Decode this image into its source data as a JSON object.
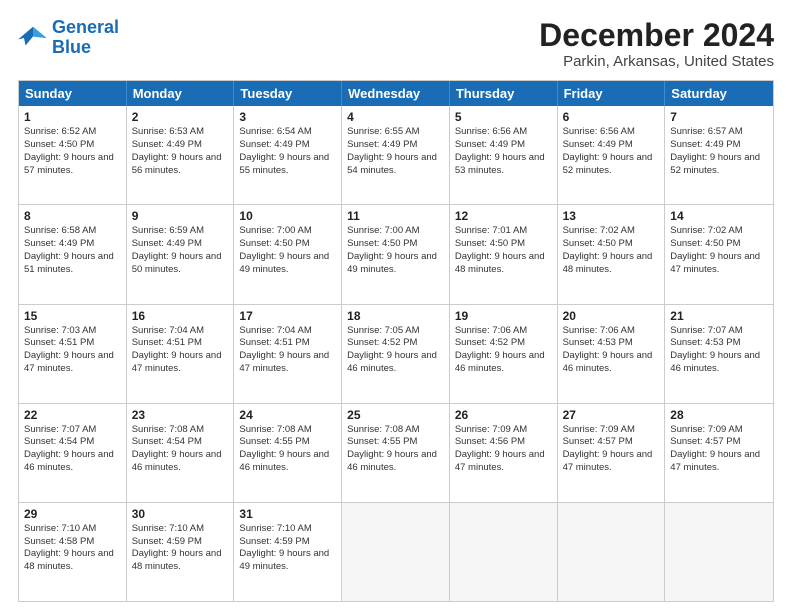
{
  "logo": {
    "line1": "General",
    "line2": "Blue"
  },
  "title": "December 2024",
  "subtitle": "Parkin, Arkansas, United States",
  "days": [
    "Sunday",
    "Monday",
    "Tuesday",
    "Wednesday",
    "Thursday",
    "Friday",
    "Saturday"
  ],
  "weeks": [
    [
      {
        "num": "1",
        "rise": "6:52 AM",
        "set": "4:50 PM",
        "daylight": "9 hours and 57 minutes."
      },
      {
        "num": "2",
        "rise": "6:53 AM",
        "set": "4:49 PM",
        "daylight": "9 hours and 56 minutes."
      },
      {
        "num": "3",
        "rise": "6:54 AM",
        "set": "4:49 PM",
        "daylight": "9 hours and 55 minutes."
      },
      {
        "num": "4",
        "rise": "6:55 AM",
        "set": "4:49 PM",
        "daylight": "9 hours and 54 minutes."
      },
      {
        "num": "5",
        "rise": "6:56 AM",
        "set": "4:49 PM",
        "daylight": "9 hours and 53 minutes."
      },
      {
        "num": "6",
        "rise": "6:56 AM",
        "set": "4:49 PM",
        "daylight": "9 hours and 52 minutes."
      },
      {
        "num": "7",
        "rise": "6:57 AM",
        "set": "4:49 PM",
        "daylight": "9 hours and 52 minutes."
      }
    ],
    [
      {
        "num": "8",
        "rise": "6:58 AM",
        "set": "4:49 PM",
        "daylight": "9 hours and 51 minutes."
      },
      {
        "num": "9",
        "rise": "6:59 AM",
        "set": "4:49 PM",
        "daylight": "9 hours and 50 minutes."
      },
      {
        "num": "10",
        "rise": "7:00 AM",
        "set": "4:50 PM",
        "daylight": "9 hours and 49 minutes."
      },
      {
        "num": "11",
        "rise": "7:00 AM",
        "set": "4:50 PM",
        "daylight": "9 hours and 49 minutes."
      },
      {
        "num": "12",
        "rise": "7:01 AM",
        "set": "4:50 PM",
        "daylight": "9 hours and 48 minutes."
      },
      {
        "num": "13",
        "rise": "7:02 AM",
        "set": "4:50 PM",
        "daylight": "9 hours and 48 minutes."
      },
      {
        "num": "14",
        "rise": "7:02 AM",
        "set": "4:50 PM",
        "daylight": "9 hours and 47 minutes."
      }
    ],
    [
      {
        "num": "15",
        "rise": "7:03 AM",
        "set": "4:51 PM",
        "daylight": "9 hours and 47 minutes."
      },
      {
        "num": "16",
        "rise": "7:04 AM",
        "set": "4:51 PM",
        "daylight": "9 hours and 47 minutes."
      },
      {
        "num": "17",
        "rise": "7:04 AM",
        "set": "4:51 PM",
        "daylight": "9 hours and 47 minutes."
      },
      {
        "num": "18",
        "rise": "7:05 AM",
        "set": "4:52 PM",
        "daylight": "9 hours and 46 minutes."
      },
      {
        "num": "19",
        "rise": "7:06 AM",
        "set": "4:52 PM",
        "daylight": "9 hours and 46 minutes."
      },
      {
        "num": "20",
        "rise": "7:06 AM",
        "set": "4:53 PM",
        "daylight": "9 hours and 46 minutes."
      },
      {
        "num": "21",
        "rise": "7:07 AM",
        "set": "4:53 PM",
        "daylight": "9 hours and 46 minutes."
      }
    ],
    [
      {
        "num": "22",
        "rise": "7:07 AM",
        "set": "4:54 PM",
        "daylight": "9 hours and 46 minutes."
      },
      {
        "num": "23",
        "rise": "7:08 AM",
        "set": "4:54 PM",
        "daylight": "9 hours and 46 minutes."
      },
      {
        "num": "24",
        "rise": "7:08 AM",
        "set": "4:55 PM",
        "daylight": "9 hours and 46 minutes."
      },
      {
        "num": "25",
        "rise": "7:08 AM",
        "set": "4:55 PM",
        "daylight": "9 hours and 46 minutes."
      },
      {
        "num": "26",
        "rise": "7:09 AM",
        "set": "4:56 PM",
        "daylight": "9 hours and 47 minutes."
      },
      {
        "num": "27",
        "rise": "7:09 AM",
        "set": "4:57 PM",
        "daylight": "9 hours and 47 minutes."
      },
      {
        "num": "28",
        "rise": "7:09 AM",
        "set": "4:57 PM",
        "daylight": "9 hours and 47 minutes."
      }
    ],
    [
      {
        "num": "29",
        "rise": "7:10 AM",
        "set": "4:58 PM",
        "daylight": "9 hours and 48 minutes."
      },
      {
        "num": "30",
        "rise": "7:10 AM",
        "set": "4:59 PM",
        "daylight": "9 hours and 48 minutes."
      },
      {
        "num": "31",
        "rise": "7:10 AM",
        "set": "4:59 PM",
        "daylight": "9 hours and 49 minutes."
      },
      null,
      null,
      null,
      null
    ]
  ]
}
